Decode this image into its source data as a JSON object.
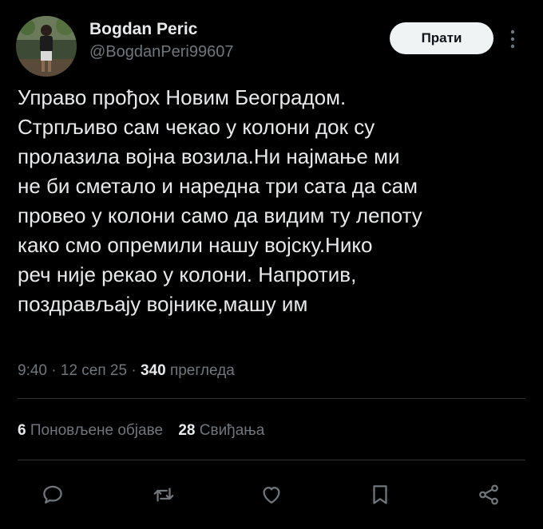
{
  "author": {
    "display_name": "Bogdan Peric",
    "handle": "@BogdanPeri99607"
  },
  "follow_label": "Прати",
  "tweet_text": "Управо прођох Новим Београдом.\nСтрпљиво сам чекао у колони док су\nпролазила војна возила.Ни најмање ми\nне би сметало и наредна три сата да сам\nпровео у колони само да видим ту лепоту\nкако смо опремили нашу војску.Нико\nреч није рекао у колони. Напротив,\nпоздрављају војнике,машу им",
  "meta": {
    "time": "9:40",
    "sep": " · ",
    "date": "12 сеп 25",
    "views_count": "340",
    "views_label": "прегледа"
  },
  "stats": {
    "reposts_count": "6",
    "reposts_label": "Поновљене објаве",
    "likes_count": "28",
    "likes_label": "Свиђања"
  },
  "icons": {
    "reply": "reply-icon",
    "repost": "repost-icon",
    "like": "heart-icon",
    "bookmark": "bookmark-icon",
    "share": "share-icon",
    "more": "more-icon"
  },
  "colors": {
    "background": "#000000",
    "text": "#e7e9ea",
    "secondary": "#71767b",
    "divider": "#2f3336",
    "follow_bg": "#eff3f4"
  }
}
